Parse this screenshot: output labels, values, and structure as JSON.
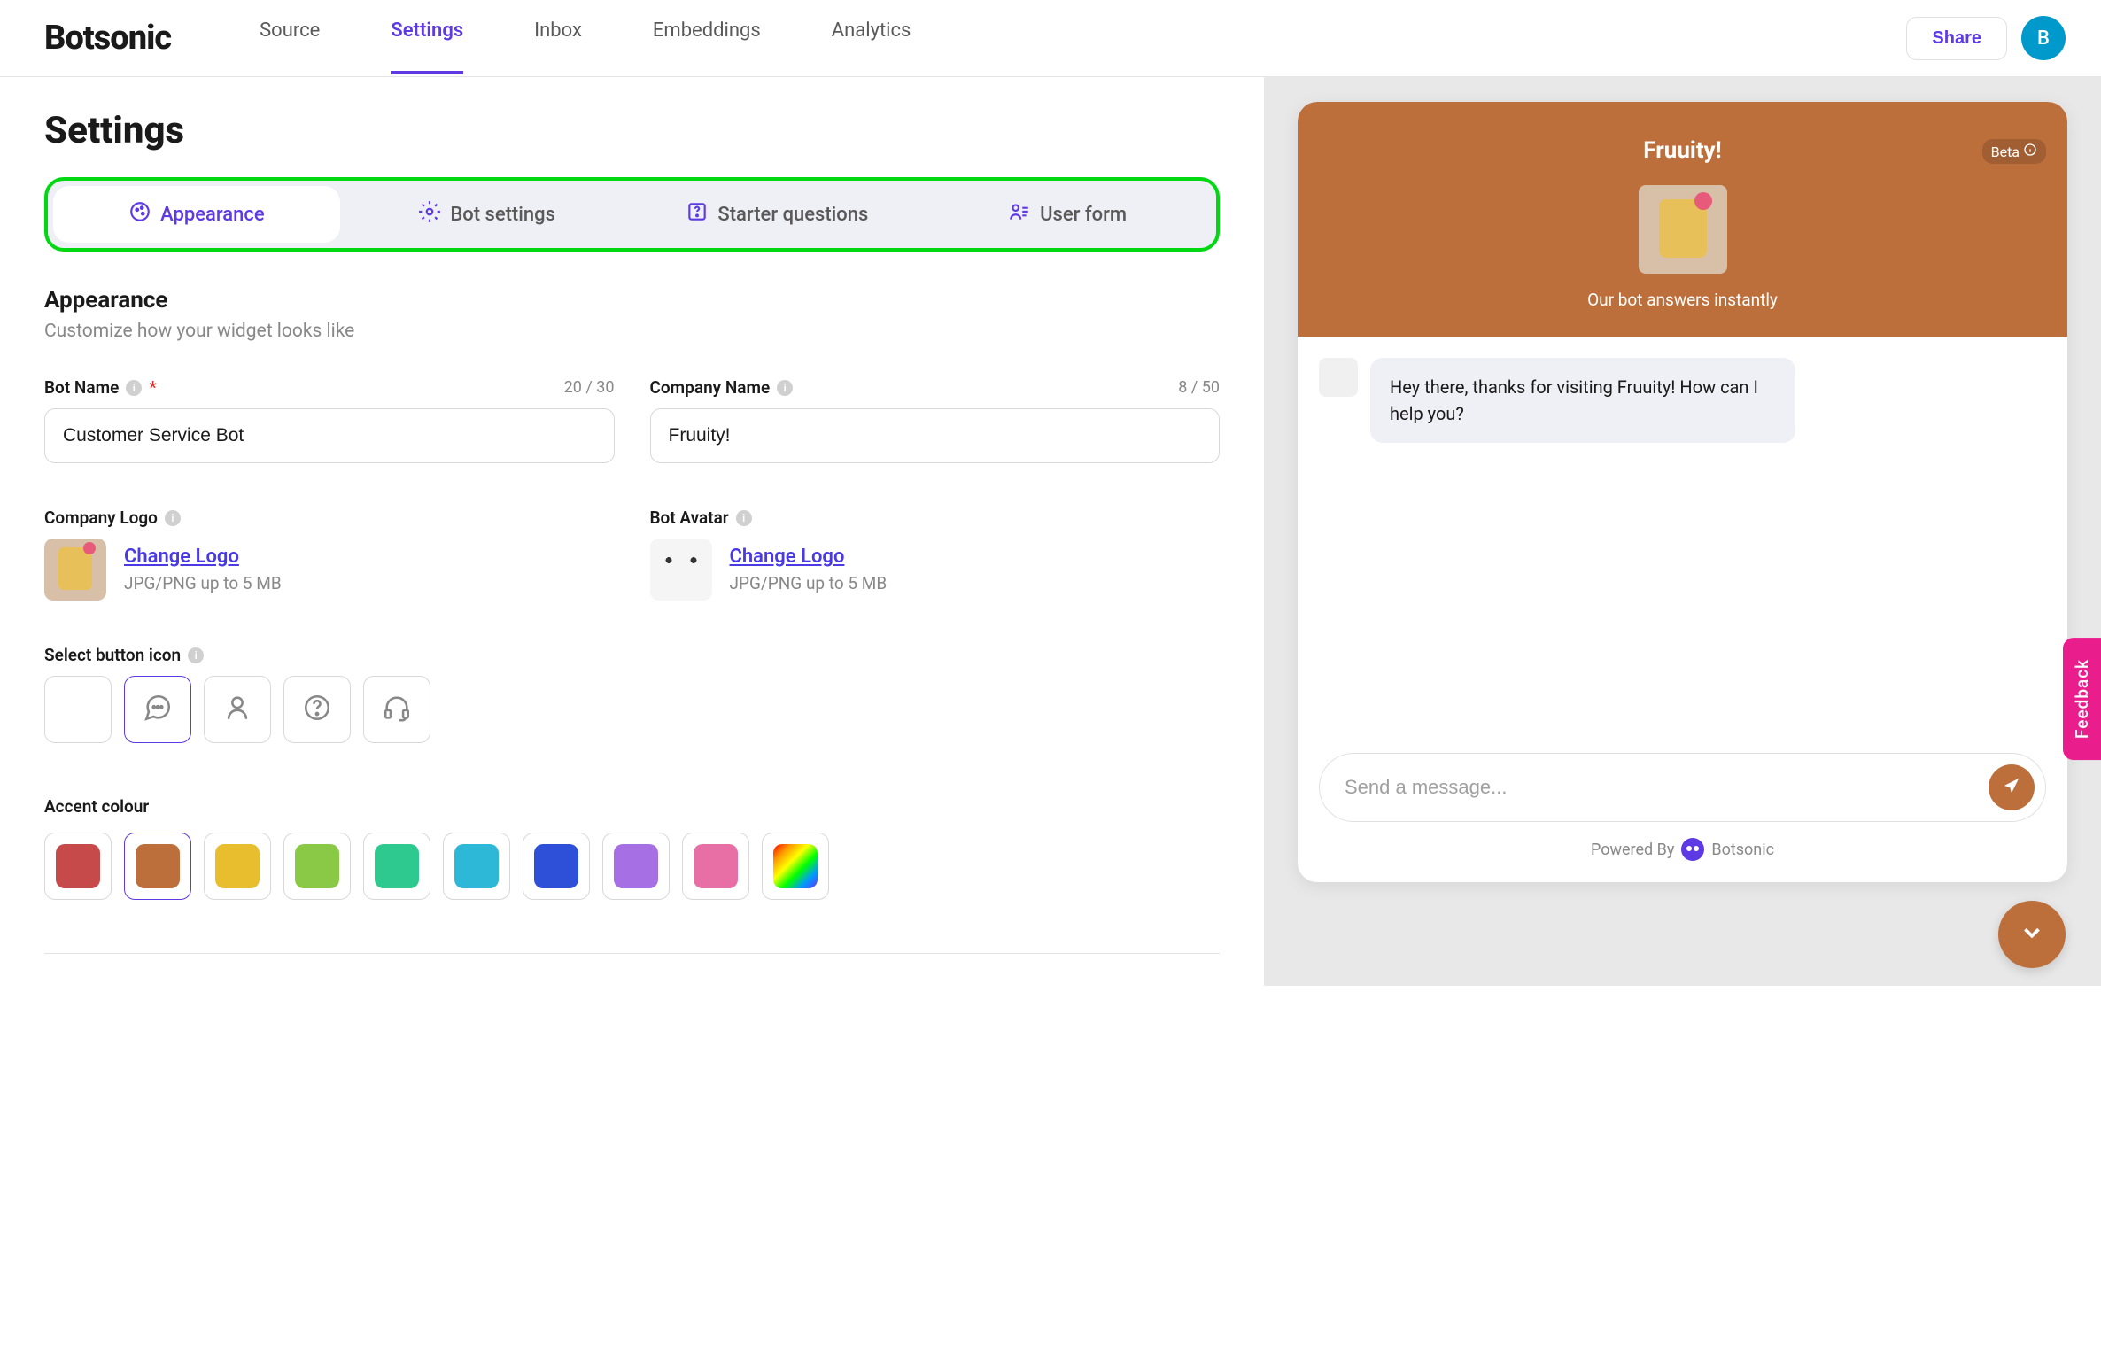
{
  "header": {
    "logo": "Botsonic",
    "nav": {
      "source": "Source",
      "settings": "Settings",
      "inbox": "Inbox",
      "embeddings": "Embeddings",
      "analytics": "Analytics"
    },
    "share": "Share",
    "avatar_initial": "B"
  },
  "page": {
    "title": "Settings"
  },
  "tabs": {
    "appearance": "Appearance",
    "bot_settings": "Bot settings",
    "starter_questions": "Starter questions",
    "user_form": "User form"
  },
  "section": {
    "title": "Appearance",
    "subtitle": "Customize how your widget looks like"
  },
  "form": {
    "bot_name": {
      "label": "Bot Name",
      "counter": "20 / 30",
      "value": "Customer Service Bot"
    },
    "company_name": {
      "label": "Company Name",
      "counter": "8 / 50",
      "value": "Fruuity!"
    },
    "company_logo": {
      "label": "Company Logo",
      "change": "Change Logo",
      "hint": "JPG/PNG up to 5 MB"
    },
    "bot_avatar": {
      "label": "Bot Avatar",
      "change": "Change Logo",
      "hint": "JPG/PNG up to 5 MB"
    },
    "button_icon": {
      "label": "Select button icon"
    },
    "accent": {
      "label": "Accent colour",
      "colors": [
        "#c74a4a",
        "#bd6f3b",
        "#e8bd2e",
        "#8ac945",
        "#2ec98e",
        "#2eb8d8",
        "#2e4fd8",
        "#a66fe4",
        "#e86fa6"
      ]
    }
  },
  "preview": {
    "title": "Fruuity!",
    "beta": "Beta",
    "subtitle": "Our bot answers instantly",
    "message": "Hey there, thanks for visiting Fruuity! How can I help you?",
    "placeholder": "Send a message...",
    "powered_prefix": "Powered By",
    "powered_brand": "Botsonic"
  },
  "feedback": "Feedback"
}
